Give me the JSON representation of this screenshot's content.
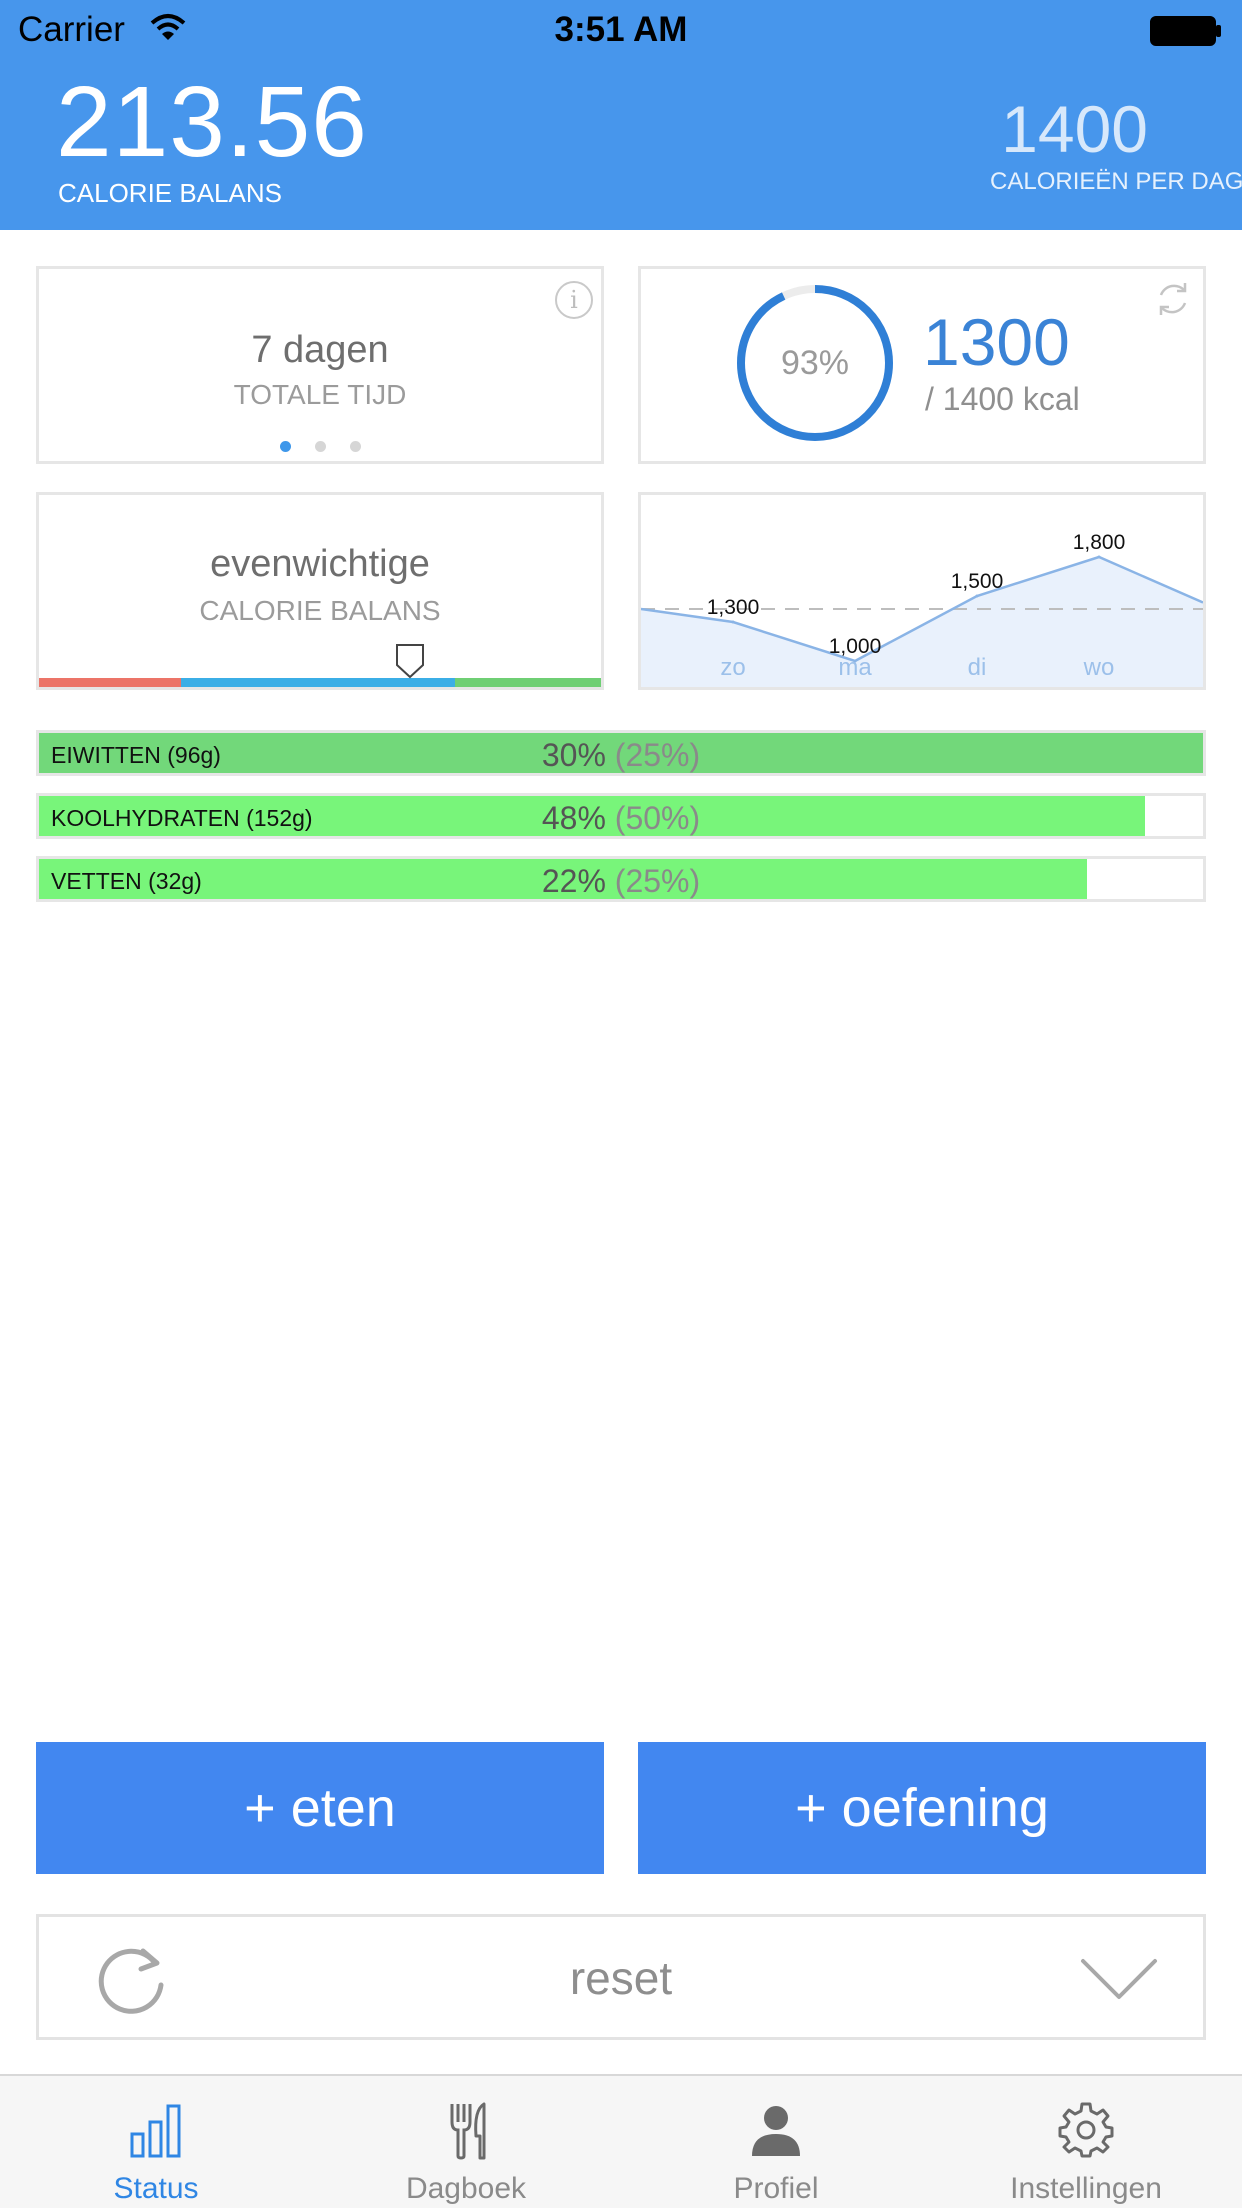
{
  "status_bar": {
    "carrier": "Carrier",
    "time": "3:51 AM"
  },
  "header": {
    "balance_value": "213.56",
    "balance_label": "CALORIE BALANS",
    "per_day_value": "1400",
    "per_day_label": "CALORIEËN PER DAG"
  },
  "cards": {
    "duration": {
      "value": "7 dagen",
      "label": "TOTALE TIJD",
      "info": "i",
      "page_count": 3,
      "active_page": 1
    },
    "progress": {
      "percent_label": "93%",
      "percent": 0.93,
      "value": "1300",
      "target": "/ 1400 kcal"
    },
    "balance": {
      "value": "evenwichtige",
      "label": "CALORIE BALANS",
      "marker_position": 0.66
    },
    "chart": {
      "chart_data": {
        "type": "line",
        "categories": [
          "zo",
          "ma",
          "di",
          "wo"
        ],
        "values": [
          1300,
          1000,
          1500,
          1800
        ],
        "value_labels": [
          "1,300",
          "1,000",
          "1,500",
          "1,800"
        ],
        "target_line": 1400
      }
    }
  },
  "macros": [
    {
      "name": "EIWITTEN (96g)",
      "pct": "30%",
      "goal": "(25%)",
      "fill": 1.0,
      "color": "#72d87a"
    },
    {
      "name": "KOOLHYDRATEN (152g)",
      "pct": "48%",
      "goal": "(50%)",
      "fill": 0.95,
      "color": "#78f57a"
    },
    {
      "name": "VETTEN (32g)",
      "pct": "22%",
      "goal": "(25%)",
      "fill": 0.9,
      "color": "#78f57a"
    }
  ],
  "actions": {
    "add_food": "+ eten",
    "add_exercise": "+ oefening",
    "reset": "reset"
  },
  "tabs": [
    {
      "label": "Status",
      "icon": "bar-chart-icon",
      "active": true
    },
    {
      "label": "Dagboek",
      "icon": "fork-knife-icon",
      "active": false
    },
    {
      "label": "Profiel",
      "icon": "person-icon",
      "active": false
    },
    {
      "label": "Instellingen",
      "icon": "gear-icon",
      "active": false
    }
  ],
  "colors": {
    "header": "#4796ec",
    "accent": "#3a83d6",
    "button": "#4287f0"
  }
}
